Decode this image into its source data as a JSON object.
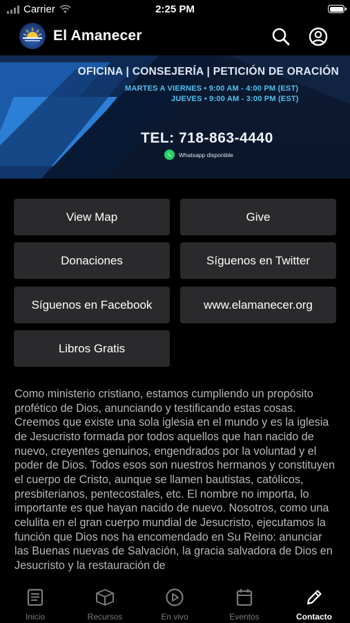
{
  "status_bar": {
    "carrier": "Carrier",
    "time": "2:25 PM"
  },
  "header": {
    "title": "El Amanecer"
  },
  "banner": {
    "title": "OFICINA | CONSEJERÍA | PETICIÓN DE ORACIÓN",
    "hours_row1": "MARTES A VIERNES  •  9:00 AM - 4:00 PM (EST)",
    "hours_row2": "JUEVES  •  9:00 AM - 3:00 PM (EST)",
    "tel": "TEL: 718-863-4440",
    "whatsapp": "Whatsapp disponible"
  },
  "buttons": [
    {
      "label": "View Map"
    },
    {
      "label": "Give"
    },
    {
      "label": "Donaciones"
    },
    {
      "label": "Síguenos en Twitter"
    },
    {
      "label": "Síguenos en Facebook"
    },
    {
      "label": "www.elamanecer.org"
    },
    {
      "label": "Libros Gratis"
    }
  ],
  "description": "Como ministerio cristiano, estamos cumpliendo un propósito profético de Dios, anunciando y testificando estas cosas. Creemos que existe una sola iglesia en el mundo y es la iglesia de Jesucristo formada por todos aquellos que han nacido de nuevo, creyentes genuinos, engendrados por la voluntad y el poder de Dios. Todos esos son nuestros hermanos y constituyen el cuerpo de Cristo, aunque se llamen bautistas, católicos, presbiterianos, pentecostales, etc. El nombre no importa, lo importante es que hayan nacido de nuevo. Nosotros, como una celulita en el gran cuerpo mundial de Jesucristo, ejecutamos la función que Dios nos ha encomendado en Su Reino: anunciar las Buenas nuevas de Salvación, la gracia salvadora de Dios en Jesucristo y la restauración de",
  "tabs": [
    {
      "label": "Inicio",
      "icon": "book-icon"
    },
    {
      "label": "Recursos",
      "icon": "box-icon"
    },
    {
      "label": "En vivo",
      "icon": "play-circle-icon"
    },
    {
      "label": "Eventos",
      "icon": "calendar-icon"
    },
    {
      "label": "Contacto",
      "icon": "pencil-icon",
      "active": true
    }
  ],
  "colors": {
    "background": "#000000",
    "button": "#2a2a2c",
    "accent_blue": "#52c2ee",
    "tab_inactive": "#7b7b7b"
  }
}
